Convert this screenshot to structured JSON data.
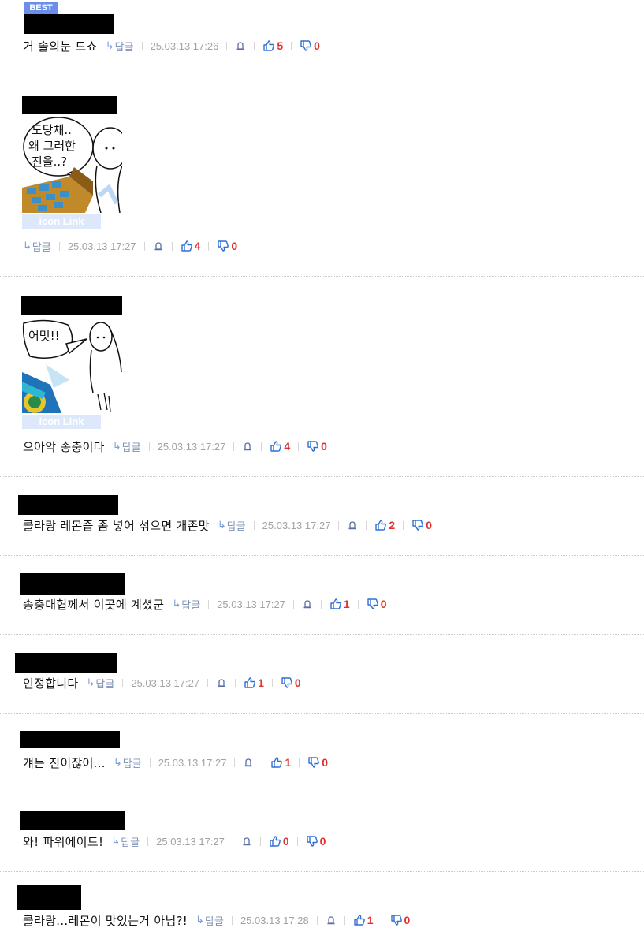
{
  "best_badge": "BEST",
  "reply_label": "답글",
  "image_caption": "icon Link",
  "comments": [
    {
      "text": "거 솔의눈 드쇼",
      "date": "25.03.13 17:26",
      "up": "5",
      "down": "0"
    },
    {
      "text": "",
      "date": "25.03.13 17:27",
      "up": "4",
      "down": "0",
      "image": {
        "bubble_lines": [
          "도당채..",
          "왜 그러한",
          "진을..?"
        ]
      }
    },
    {
      "text": "으아악 송충이다",
      "date": "25.03.13 17:27",
      "up": "4",
      "down": "0",
      "image": {
        "bubble_lines": [
          "어멋!!"
        ]
      }
    },
    {
      "text": "콜라랑 레몬즙 좀 넣어 섞으면 개존맛",
      "date": "25.03.13 17:27",
      "up": "2",
      "down": "0"
    },
    {
      "text": "송충대협께서 이곳에 계셨군",
      "date": "25.03.13 17:27",
      "up": "1",
      "down": "0"
    },
    {
      "text": "인정합니다",
      "date": "25.03.13 17:27",
      "up": "1",
      "down": "0"
    },
    {
      "text": "걔는 진이잖어...",
      "date": "25.03.13 17:27",
      "up": "1",
      "down": "0"
    },
    {
      "text": "와! 파워에이드!",
      "date": "25.03.13 17:27",
      "up": "0",
      "down": "0"
    },
    {
      "text": "콜라랑...레몬이 맛있는거 아님?!",
      "date": "25.03.13 17:28",
      "up": "1",
      "down": "0"
    }
  ]
}
